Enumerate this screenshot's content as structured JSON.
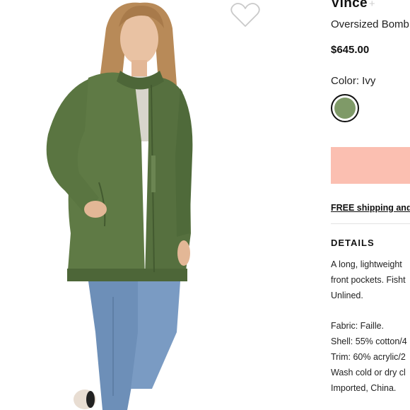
{
  "product": {
    "brand": "Vince",
    "brand_plus": "+",
    "name": "Oversized Bomb",
    "price": "$645.00"
  },
  "color": {
    "label": "Color: Ivy",
    "swatch_hex": "#7f9a68"
  },
  "add_to_bag": {
    "label": "",
    "color": "#fbbfb1"
  },
  "shipping": {
    "text": "FREE shipping and"
  },
  "details": {
    "heading": "DETAILS",
    "description_lines": [
      "A long, lightweight",
      "front pockets. Fisht",
      "Unlined."
    ],
    "spec_lines": [
      "Fabric: Faille.",
      "Shell: 55% cotton/4",
      "Trim: 60% acrylic/2",
      "Wash cold or dry cl",
      "Imported, China."
    ]
  },
  "icons": {
    "wishlist": "heart-outline-icon"
  },
  "colors": {
    "jacket": "#5f7a45",
    "jeans": "#6d8fb8",
    "hair": "#b88a58"
  }
}
